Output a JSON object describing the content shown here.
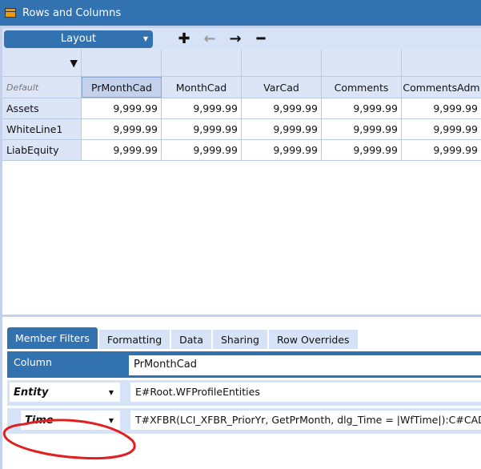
{
  "window": {
    "title": "Rows and Columns"
  },
  "toolbar": {
    "layout_label": "Layout",
    "icons": [
      "plus-icon",
      "arrow-left-icon",
      "arrow-right-icon",
      "minus-icon"
    ]
  },
  "grid": {
    "corner_label": "Default",
    "columns": [
      "PrMonthCad",
      "MonthCad",
      "VarCad",
      "Comments",
      "CommentsAdm"
    ],
    "rows": [
      {
        "label": "Assets",
        "values": [
          "9,999.99",
          "9,999.99",
          "9,999.99",
          "9,999.99",
          "9,999.99"
        ]
      },
      {
        "label": "WhiteLine1",
        "values": [
          "9,999.99",
          "9,999.99",
          "9,999.99",
          "9,999.99",
          "9,999.99"
        ]
      },
      {
        "label": "LiabEquity",
        "values": [
          "9,999.99",
          "9,999.99",
          "9,999.99",
          "9,999.99",
          "9,999.99"
        ]
      }
    ]
  },
  "tabs": [
    "Member Filters",
    "Formatting",
    "Data",
    "Sharing",
    "Row Overrides"
  ],
  "filters": {
    "column_label": "Column",
    "column_value": "PrMonthCad",
    "entity_label": "Entity",
    "entity_value": "E#Root.WFProfileEntities",
    "time_label": "Time",
    "time_value": "T#XFBR(LCI_XFBR_PriorYr, GetPrMonth, dlg_Time = |WfTime|):C#CAD:N"
  },
  "colors": {
    "accent": "#3272b0",
    "light": "#d6e2f5",
    "annotation": "#e02020"
  }
}
